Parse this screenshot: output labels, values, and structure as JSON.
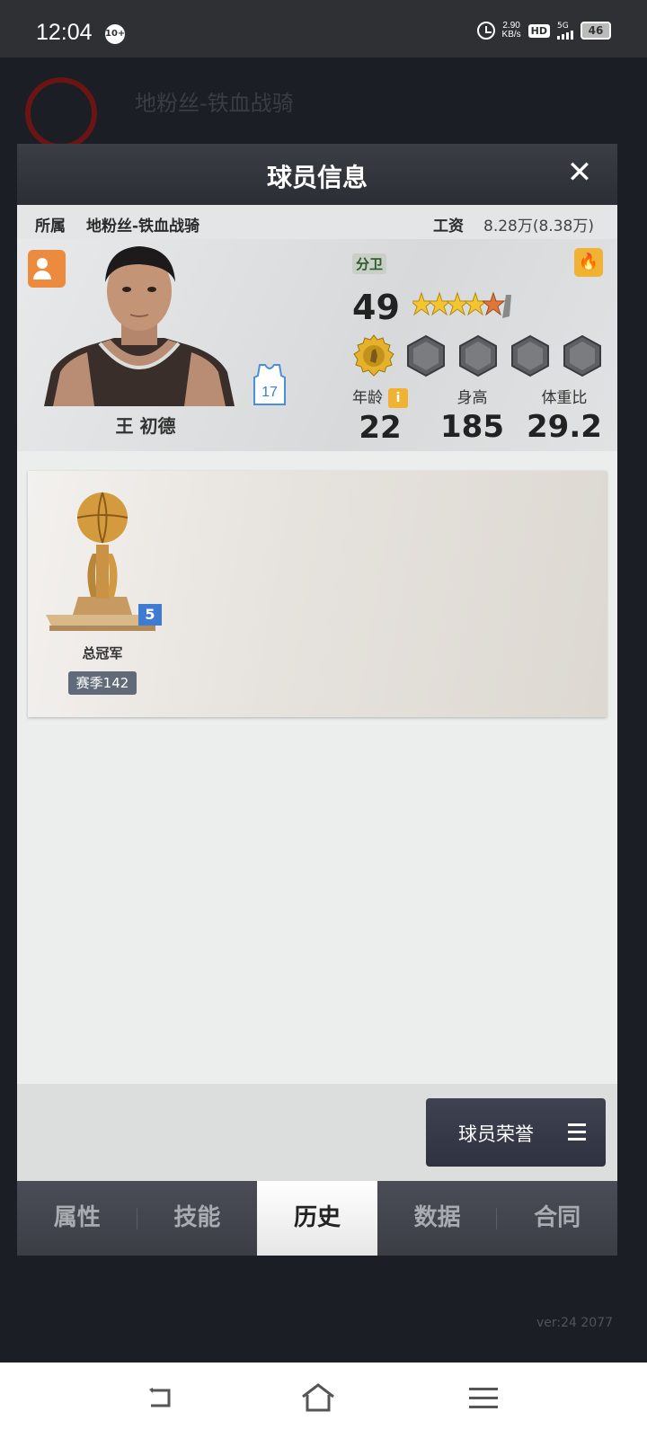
{
  "status_bar": {
    "time": "12:04",
    "notification_count": "10+",
    "net_speed_value": "2.90",
    "net_speed_unit": "KB/s",
    "hd_label": "HD",
    "network": "5G",
    "battery": "46"
  },
  "background": {
    "team_name": "地粉丝-铁血战骑",
    "version": "ver:24  2077"
  },
  "dialog": {
    "title": "球员信息",
    "close_icon": "close-icon",
    "team_label": "所属",
    "team_name": "地粉丝-铁血战骑",
    "salary_label": "工资",
    "salary_value": "8.28万(8.38万)"
  },
  "player": {
    "name": "王 初德",
    "jersey_number": "17",
    "position": "分卫",
    "rating": "49",
    "stars": 4.5,
    "age_label": "年龄",
    "age": "22",
    "height_label": "身高",
    "height": "185",
    "weight_label": "体重比",
    "weight_ratio": "29.2",
    "info_icon": "i"
  },
  "honors": [
    {
      "title": "总冠军",
      "count": "5",
      "season": "赛季142"
    }
  ],
  "footer": {
    "honor_button": "球员荣誉"
  },
  "tabs": [
    {
      "label": "属性"
    },
    {
      "label": "技能"
    },
    {
      "label": "历史"
    },
    {
      "label": "数据"
    },
    {
      "label": "合同"
    }
  ],
  "active_tab": "历史",
  "colors": {
    "accent_orange": "#ec8a3d",
    "accent_gold": "#f0b232",
    "count_blue": "#3e7bd1"
  }
}
